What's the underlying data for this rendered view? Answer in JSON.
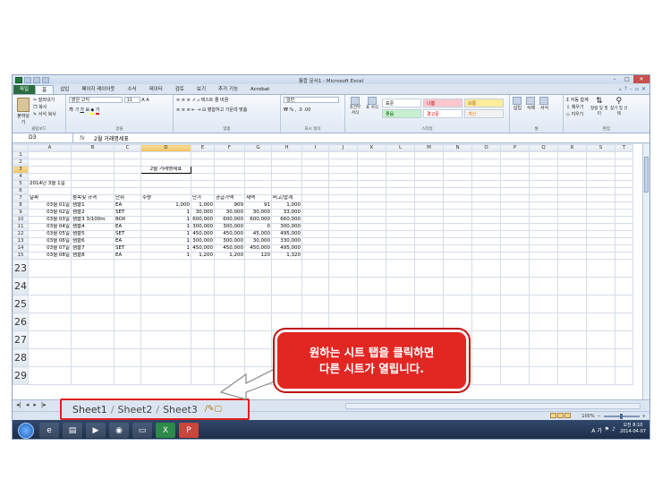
{
  "window": {
    "title": "통합 문서1 - Microsoft Excel"
  },
  "ribbon_tabs": [
    "파일",
    "홈",
    "삽입",
    "페이지 레이아웃",
    "수식",
    "데이터",
    "검토",
    "보기",
    "추가 기능",
    "Acrobat"
  ],
  "ribbon": {
    "clipboard": {
      "paste": "붙여넣기",
      "cut": "잘라내기",
      "copy": "복사",
      "format_painter": "서식 복사",
      "group": "클립보드"
    },
    "font": {
      "name": "맑은 고딕",
      "size": "11",
      "group": "글꼴"
    },
    "alignment": {
      "wrap": "텍스트 줄 바꿈",
      "merge": "병합하고 가운데 맞춤",
      "group": "맞춤"
    },
    "number": {
      "format": "일반",
      "group": "표시 형식"
    },
    "styles": {
      "conditional": "조건부 서식",
      "table": "표 서식",
      "cells": [
        "표준",
        "나쁨",
        "보통",
        "좋음",
        "경고문",
        "계산"
      ],
      "group": "스타일"
    },
    "cells_group": {
      "insert": "삽입",
      "delete": "삭제",
      "format": "서식",
      "group": "셀"
    },
    "editing": {
      "autosum": "자동 합계",
      "fill": "채우기",
      "clear": "지우기",
      "sort": "정렬 및 필터",
      "find": "찾기 및 선택",
      "group": "편집"
    }
  },
  "formula_bar": {
    "name_box": "D3",
    "fx": "fx",
    "value": "2월 거래명세표"
  },
  "columns": [
    "A",
    "B",
    "C",
    "D",
    "E",
    "F",
    "G",
    "H",
    "I",
    "J",
    "K",
    "L",
    "M",
    "N",
    "O",
    "P",
    "Q",
    "R",
    "S",
    "T"
  ],
  "rows": [
    {
      "n": "1",
      "cells": []
    },
    {
      "n": "2",
      "cells": []
    },
    {
      "n": "3",
      "cells": [
        {
          "col": "D",
          "v": "2월 거래명세표"
        }
      ]
    },
    {
      "n": "4",
      "cells": []
    },
    {
      "n": "5",
      "cells": [
        {
          "col": "A",
          "v": "2014년 3월 1일"
        }
      ]
    },
    {
      "n": "6",
      "cells": []
    },
    {
      "n": "7",
      "cells": [
        {
          "col": "A",
          "v": "날짜"
        },
        {
          "col": "B",
          "v": "품목및 규격"
        },
        {
          "col": "C",
          "v": "단위"
        },
        {
          "col": "D",
          "v": "수량"
        },
        {
          "col": "E",
          "v": "단가"
        },
        {
          "col": "F",
          "v": "공급가액"
        },
        {
          "col": "G",
          "v": "세액"
        },
        {
          "col": "H",
          "v": "비고/합계"
        }
      ]
    },
    {
      "n": "8",
      "cells": [
        {
          "col": "A",
          "v": "03월 01일"
        },
        {
          "col": "B",
          "v": "샘플1"
        },
        {
          "col": "C",
          "v": "EA"
        },
        {
          "col": "D",
          "v": "1,000"
        },
        {
          "col": "E",
          "v": "1,000"
        },
        {
          "col": "F",
          "v": "909"
        },
        {
          "col": "G",
          "v": "91"
        },
        {
          "col": "H",
          "v": "1,000"
        }
      ]
    },
    {
      "n": "9",
      "cells": [
        {
          "col": "A",
          "v": "03월 02일"
        },
        {
          "col": "B",
          "v": "샘플2"
        },
        {
          "col": "C",
          "v": "SET"
        },
        {
          "col": "D",
          "v": "1"
        },
        {
          "col": "E",
          "v": "30,000"
        },
        {
          "col": "F",
          "v": "30,000"
        },
        {
          "col": "G",
          "v": "30,000"
        },
        {
          "col": "H",
          "v": "33,000"
        }
      ]
    },
    {
      "n": "10",
      "cells": [
        {
          "col": "A",
          "v": "03월 03일"
        },
        {
          "col": "B",
          "v": "샘플3 3/100m"
        },
        {
          "col": "C",
          "v": "BOX"
        },
        {
          "col": "D",
          "v": "1"
        },
        {
          "col": "E",
          "v": "600,000"
        },
        {
          "col": "F",
          "v": "600,000"
        },
        {
          "col": "G",
          "v": "600,000"
        },
        {
          "col": "H",
          "v": "660,000"
        }
      ]
    },
    {
      "n": "11",
      "cells": [
        {
          "col": "A",
          "v": "03월 04일"
        },
        {
          "col": "B",
          "v": "샘플4"
        },
        {
          "col": "C",
          "v": "EA"
        },
        {
          "col": "D",
          "v": "1"
        },
        {
          "col": "E",
          "v": "300,000"
        },
        {
          "col": "F",
          "v": "300,000"
        },
        {
          "col": "G",
          "v": "0"
        },
        {
          "col": "H",
          "v": "300,000"
        }
      ]
    },
    {
      "n": "12",
      "cells": [
        {
          "col": "A",
          "v": "03월 05일"
        },
        {
          "col": "B",
          "v": "샘플5"
        },
        {
          "col": "C",
          "v": "SET"
        },
        {
          "col": "D",
          "v": "1"
        },
        {
          "col": "E",
          "v": "450,000"
        },
        {
          "col": "F",
          "v": "450,000"
        },
        {
          "col": "G",
          "v": "45,000"
        },
        {
          "col": "H",
          "v": "495,000"
        }
      ]
    },
    {
      "n": "13",
      "cells": [
        {
          "col": "A",
          "v": "03월 06일"
        },
        {
          "col": "B",
          "v": "샘플6"
        },
        {
          "col": "C",
          "v": "EA"
        },
        {
          "col": "D",
          "v": "1"
        },
        {
          "col": "E",
          "v": "300,000"
        },
        {
          "col": "F",
          "v": "300,000"
        },
        {
          "col": "G",
          "v": "30,000"
        },
        {
          "col": "H",
          "v": "330,000"
        }
      ]
    },
    {
      "n": "14",
      "cells": [
        {
          "col": "A",
          "v": "03월 07일"
        },
        {
          "col": "B",
          "v": "샘플7"
        },
        {
          "col": "C",
          "v": "SET"
        },
        {
          "col": "D",
          "v": "1"
        },
        {
          "col": "E",
          "v": "450,000"
        },
        {
          "col": "F",
          "v": "450,000"
        },
        {
          "col": "G",
          "v": "450,000"
        },
        {
          "col": "H",
          "v": "495,000"
        }
      ]
    },
    {
      "n": "15",
      "cells": [
        {
          "col": "A",
          "v": "03월 08일"
        },
        {
          "col": "B",
          "v": "샘플8"
        },
        {
          "col": "C",
          "v": "EA"
        },
        {
          "col": "D",
          "v": "1"
        },
        {
          "col": "E",
          "v": "1,200"
        },
        {
          "col": "F",
          "v": "1,200"
        },
        {
          "col": "G",
          "v": "120"
        },
        {
          "col": "H",
          "v": "1,320"
        }
      ]
    }
  ],
  "zoomed_rows": [
    "23",
    "24",
    "25",
    "26",
    "27",
    "28",
    "29"
  ],
  "sheet_tabs": [
    "Sheet1",
    "Sheet2",
    "Sheet3"
  ],
  "status_bar": {
    "zoom": "100%"
  },
  "taskbar": {
    "time": "오전 8:10",
    "date": "2014-04-07",
    "ime": "A 가"
  },
  "callout": {
    "line1": "원하는 시트 탭을 클릭하면",
    "line2": "다른 시트가 열립니다."
  },
  "colors": {
    "callout_red": "#e22622",
    "highlight_border": "#e01f1f",
    "file_tab": "#2a6e3f"
  }
}
